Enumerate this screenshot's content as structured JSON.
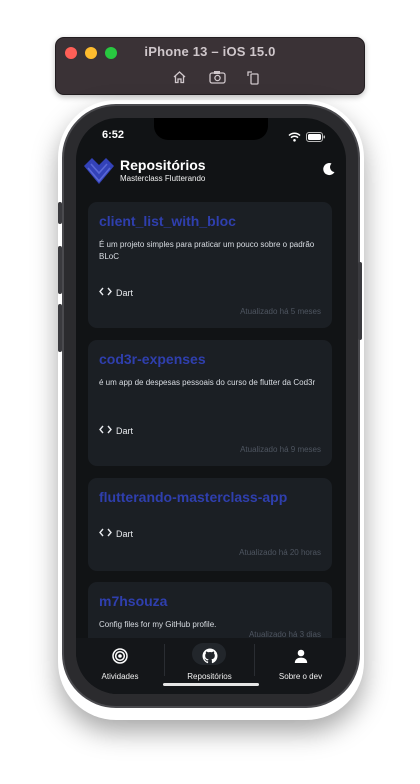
{
  "simulator": {
    "title": "iPhone 13 – iOS 15.0",
    "tools": [
      "home-icon",
      "screenshot-icon",
      "rotate-icon"
    ]
  },
  "status_bar": {
    "time": "6:52",
    "icons": [
      "signal-icon",
      "wifi-icon",
      "battery-icon"
    ]
  },
  "header": {
    "title": "Repositórios",
    "subtitle": "Masterclass Flutterando",
    "logo_color": "#3a4ab8",
    "theme_icon": "moon-icon"
  },
  "repos": [
    {
      "name": "client_list_with_bloc",
      "description": "É um projeto simples para praticar um pouco sobre o padrão BLoC",
      "language": "Dart",
      "updated": "Atualizado há 5 meses"
    },
    {
      "name": "cod3r-expenses",
      "description": "é um app de despesas pessoais do curso de flutter da Cod3r",
      "language": "Dart",
      "updated": "Atualizado há 9 meses"
    },
    {
      "name": "flutterando-masterclass-app",
      "description": "",
      "language": "Dart",
      "updated": "Atualizado há 20 horas"
    },
    {
      "name": "m7hsouza",
      "description": "Config files for my GitHub profile.",
      "language": "",
      "updated": "Atualizado há 3 dias"
    }
  ],
  "tabs": [
    {
      "label": "Atividades",
      "icon": "target-icon",
      "active": false
    },
    {
      "label": "Repositórios",
      "icon": "github-icon",
      "active": true
    },
    {
      "label": "Sobre o dev",
      "icon": "person-icon",
      "active": false
    }
  ],
  "colors": {
    "accent": "#2f3fae",
    "card": "#1b1f24",
    "screen": "#111315"
  }
}
